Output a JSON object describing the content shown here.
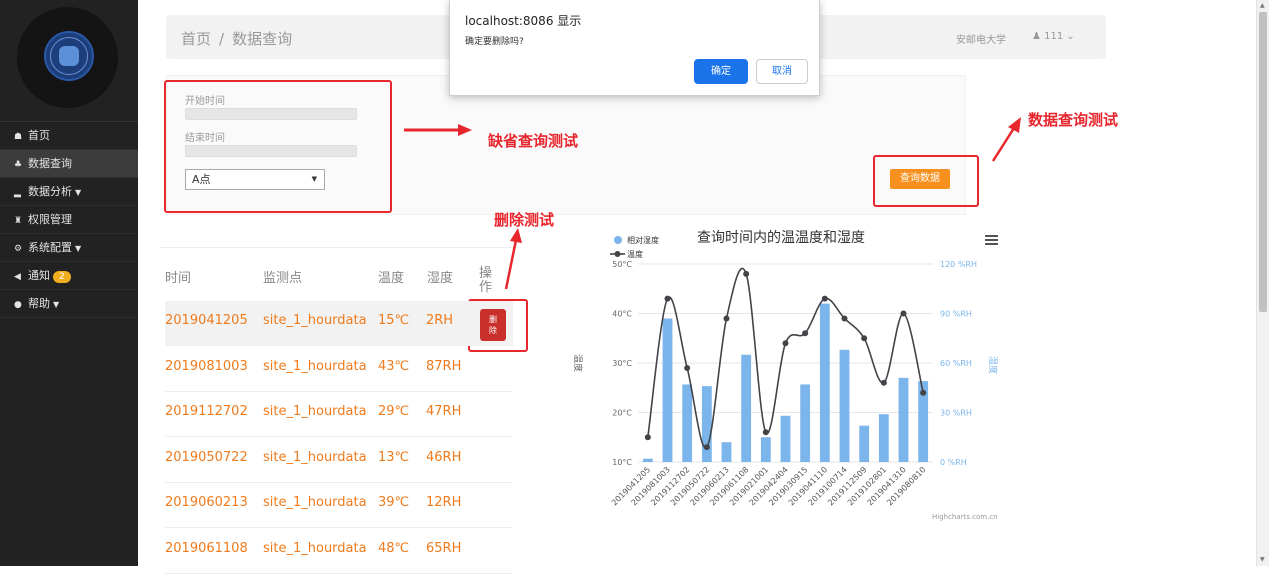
{
  "sidebar": {
    "items": [
      {
        "icon": "home-icon",
        "glyph": "☗",
        "label": "首页"
      },
      {
        "icon": "sitemap-icon",
        "glyph": "♣",
        "label": "数据查询"
      },
      {
        "icon": "signal-icon",
        "glyph": "▂",
        "label": "数据分析"
      },
      {
        "icon": "group-icon",
        "glyph": "♜",
        "label": "权限管理"
      },
      {
        "icon": "cogs-icon",
        "glyph": "⚙",
        "label": "系统配置"
      },
      {
        "icon": "bullhorn-icon",
        "glyph": "◀",
        "label": "通知",
        "badge": "2"
      },
      {
        "icon": "info-icon",
        "glyph": "●",
        "label": "帮助"
      }
    ]
  },
  "breadcrumb": {
    "home": "首页",
    "sep": "/",
    "current": "数据查询"
  },
  "header": {
    "org": "安邮电大学",
    "user": "111"
  },
  "filter": {
    "start_label": "开始时间",
    "end_label": "结束时间",
    "point_value": "A点",
    "query_button": "查询数据"
  },
  "annotations": {
    "default_query": "缺省查询测试",
    "data_query": "数据查询测试",
    "delete": "删除测试"
  },
  "table": {
    "headers": [
      "时间",
      "监测点",
      "温度",
      "湿度",
      "操作"
    ],
    "delete_label": "删除",
    "rows": [
      {
        "time": "2019041205",
        "site": "site_1_hourdata",
        "temp": "15℃",
        "hum": "2RH"
      },
      {
        "time": "2019081003",
        "site": "site_1_hourdata",
        "temp": "43℃",
        "hum": "87RH"
      },
      {
        "time": "2019112702",
        "site": "site_1_hourdata",
        "temp": "29℃",
        "hum": "47RH"
      },
      {
        "time": "2019050722",
        "site": "site_1_hourdata",
        "temp": "13℃",
        "hum": "46RH"
      },
      {
        "time": "2019060213",
        "site": "site_1_hourdata",
        "temp": "39℃",
        "hum": "12RH"
      },
      {
        "time": "2019061108",
        "site": "site_1_hourdata",
        "temp": "48℃",
        "hum": "65RH"
      }
    ]
  },
  "dialog": {
    "title": "localhost:8086 显示",
    "message": "确定要删除吗?",
    "ok": "确定",
    "cancel": "取消"
  },
  "chart_data": {
    "type": "bar+line",
    "title": "查询时间内的温温度和湿度",
    "credit": "Highcharts.com.cn",
    "categories": [
      "2019041205",
      "2019081003",
      "2019112702",
      "2019050722",
      "2019060213",
      "2019061108",
      "2019021001",
      "2019042404",
      "2019030915",
      "2019041110",
      "2019100714",
      "2019112509",
      "2019102801",
      "2019041310",
      "2019080810"
    ],
    "left_axis": {
      "label": "温度",
      "ticks": [
        "10°C",
        "20°C",
        "30°C",
        "40°C",
        "50°C"
      ],
      "range": [
        10,
        50
      ]
    },
    "right_axis": {
      "label": "湿度",
      "ticks": [
        "0 %RH",
        "30 %RH",
        "60 %RH",
        "90 %RH",
        "120 %RH"
      ],
      "range": [
        0,
        120
      ]
    },
    "series": [
      {
        "name": "相对湿度",
        "type": "column",
        "axis": "right",
        "color": "#7cb5ec",
        "values": [
          2,
          87,
          47,
          46,
          12,
          65,
          15,
          28,
          47,
          96,
          68,
          22,
          29,
          51,
          49
        ]
      },
      {
        "name": "温度",
        "type": "spline",
        "axis": "left",
        "color": "#434348",
        "values": [
          15,
          43,
          29,
          13,
          39,
          48,
          16,
          34,
          36,
          43,
          39,
          35,
          26,
          40,
          24
        ]
      }
    ],
    "legend": "top-left",
    "menu_icon": "hamburger-icon"
  }
}
